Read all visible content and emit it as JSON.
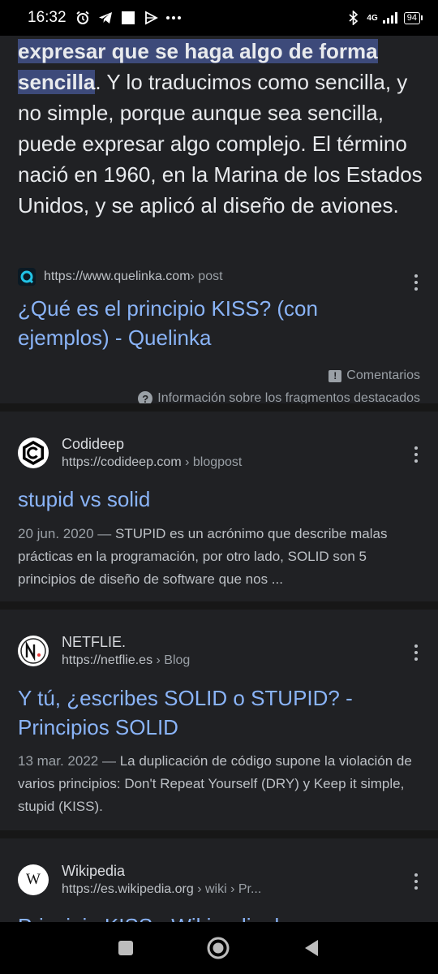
{
  "status_bar": {
    "time": "16:32",
    "network": "4G",
    "battery": "94",
    "icons": [
      "alarm-icon",
      "telegram-icon",
      "square-notification-icon",
      "play-icon",
      "more-dots-icon",
      "bluetooth-icon",
      "signal-icon",
      "battery-icon"
    ]
  },
  "featured_snippet": {
    "highlight_line1": "expresar que se haga algo de forma",
    "highlight_line2": "sencilla",
    "text": ". Y lo traducimos como sencilla, y no simple, porque aunque sea sencilla, puede expresar algo complejo. El término nació en 1960, en la Marina de los Estados Unidos, y se aplicó al diseño de aviones.",
    "source_url": "https://www.quelinka.com",
    "source_crumb": " › post",
    "link_title": "¿Qué es el principio KISS? (con ejemplos) - Quelinka",
    "feedback_label": "Comentarios",
    "info_label": "Información sobre los fragmentos destacados"
  },
  "results": [
    {
      "site_name": "Codideep",
      "url": "https://codideep.com",
      "crumb": " › blogpost",
      "title": "stupid vs solid",
      "date": "20 jun. 2020 — ",
      "description": "STUPID es un acrónimo que describe malas prácticas en la programación, por otro lado, SOLID son 5 principios de diseño de software que nos ..."
    },
    {
      "site_name": "NETFLIE.",
      "url": "https://netflie.es",
      "crumb": " › Blog",
      "title": "Y tú, ¿escribes SOLID o STUPID? - Principios SOLID",
      "date": "13 mar. 2022 — ",
      "description": "La duplicación de código supone la violación de varios principios: Don't Repeat Yourself (DRY) y Keep it simple, stupid (KISS)."
    },
    {
      "site_name": "Wikipedia",
      "url": "https://es.wikipedia.org",
      "crumb": " › wiki › Pr...",
      "title": "Principio KISS - Wikipedia, la"
    }
  ],
  "colors": {
    "background": "#202124",
    "link": "#8ab4f8",
    "highlight": "#3d4a7a"
  }
}
